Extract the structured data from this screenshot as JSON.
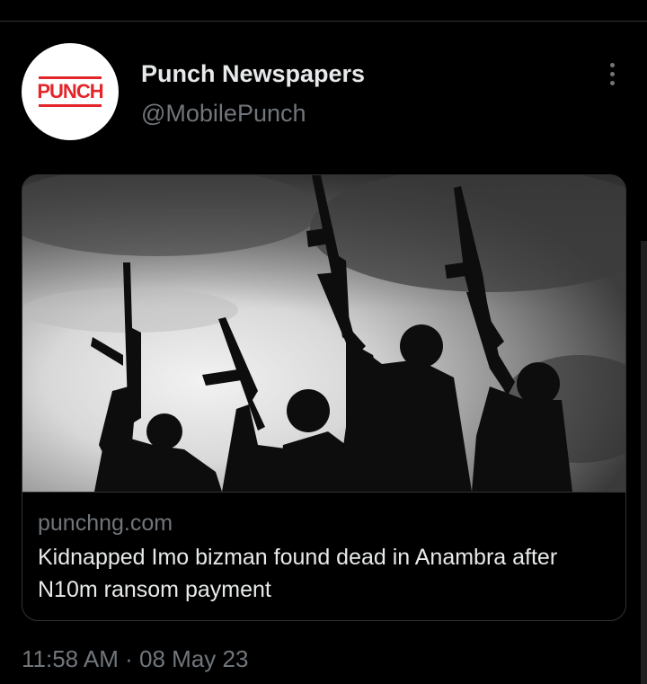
{
  "tweet": {
    "author_name": "Punch Newspapers",
    "author_handle": "@MobilePunch",
    "avatar_logo": "PUNCH",
    "timestamp": "11:58 AM · 08 May 23"
  },
  "link_card": {
    "domain": "punchng.com",
    "title": "Kidnapped Imo bizman found dead in Anambra after N10m ransom payment"
  },
  "icons": {
    "more": "more-horizontal-icon"
  },
  "colors": {
    "background": "#000000",
    "primary_text": "#e7e9ea",
    "secondary_text": "#71767b",
    "border": "#2f3336",
    "punch_red": "#e3262a"
  }
}
